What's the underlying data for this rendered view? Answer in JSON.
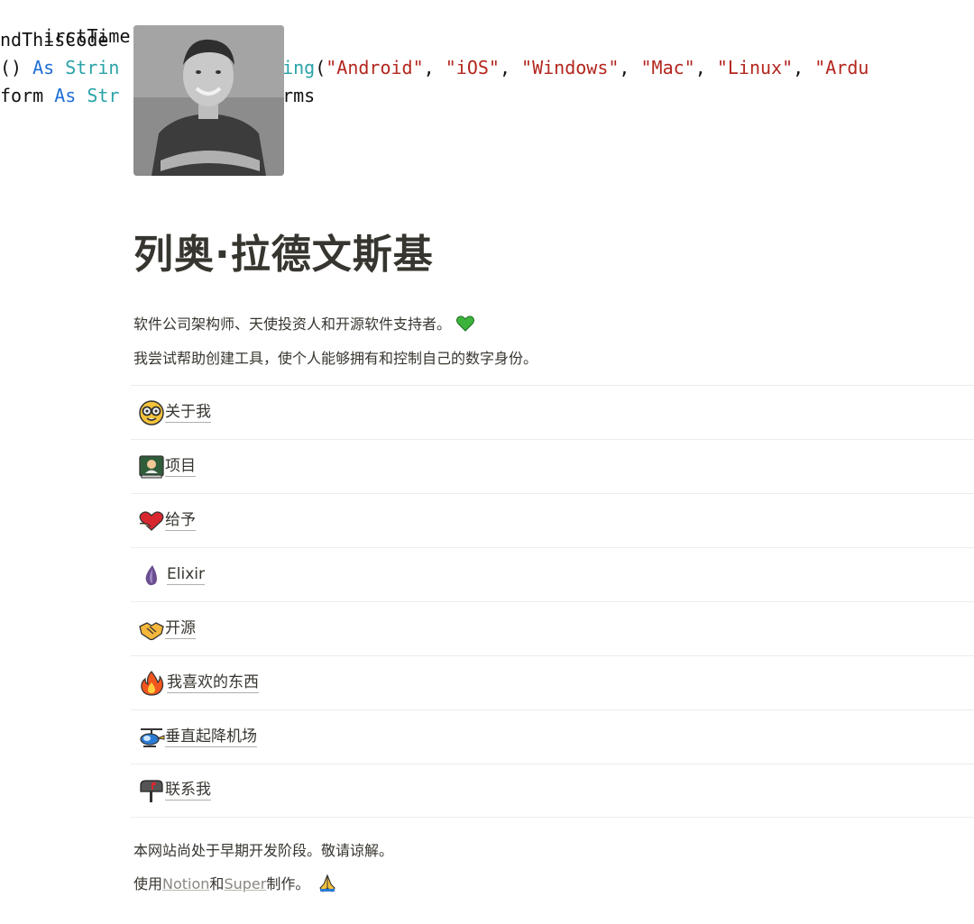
{
  "cover": {
    "line1": "irstTime As Boolean)",
    "line2": "ndThisCode",
    "line3_a": "() As Strin",
    "line3_b": "String(",
    "line3_c": "\"Android\", \"iOS\", \"Windows\", \"Mac\", \"Linux\", \"Ardu",
    "line4_a": "form As Str",
    "line4_b": "orms"
  },
  "profile": {
    "name": "列奥·拉德文斯基",
    "bio1": "软件公司架构师、天使投资人和开源软件支持者。",
    "bio2": "我尝试帮助创建工具，使个人能够拥有和控制自己的数字身份。",
    "avatar_icon": "portrait-photo"
  },
  "menu": [
    {
      "label": "关于我",
      "icon": "nerd-face-icon"
    },
    {
      "label": "项目",
      "icon": "technologist-icon"
    },
    {
      "label": "给予",
      "icon": "heart-hands-icon"
    },
    {
      "label": "Elixir",
      "icon": "elixir-drop-icon"
    },
    {
      "label": "开源",
      "icon": "handshake-icon"
    },
    {
      "label": "我喜欢的东西",
      "icon": "fire-icon"
    },
    {
      "label": "垂直起降机场",
      "icon": "helicopter-icon"
    },
    {
      "label": "联系我",
      "icon": "mailbox-icon"
    }
  ],
  "footer": {
    "line1": "本网站尚处于早期开发阶段。敬请谅解。",
    "prefix": "使用",
    "link_notion": "Notion",
    "and": "和",
    "link_super": "Super",
    "suffix": "制作。"
  },
  "colors": {
    "text": "#37352f",
    "divider": "#ececea",
    "heart": "#3cb43c"
  }
}
